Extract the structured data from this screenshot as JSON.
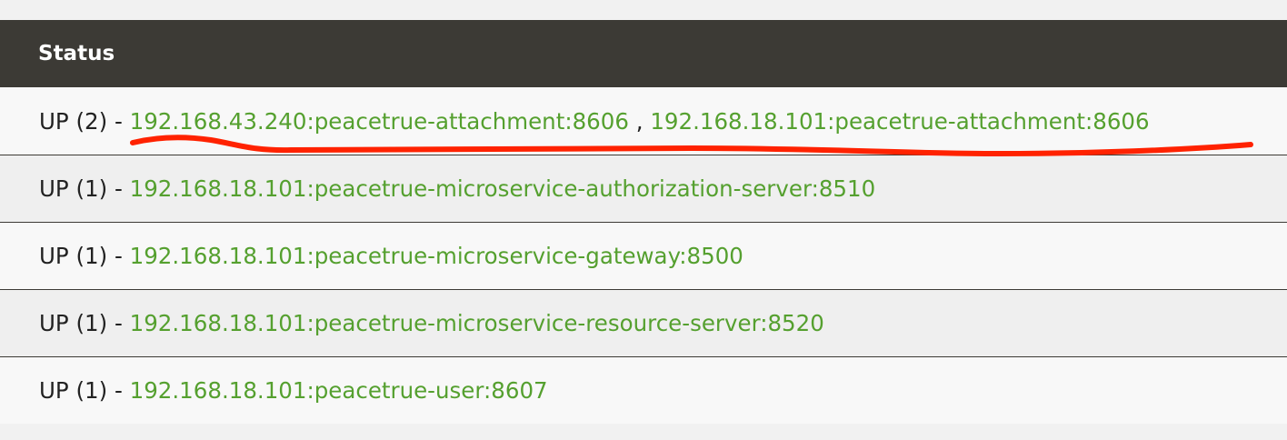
{
  "table": {
    "header": "Status",
    "rows": [
      {
        "status": "UP (2)",
        "separator": " - ",
        "links": [
          "192.168.43.240:peacetrue-attachment:8606",
          "192.168.18.101:peacetrue-attachment:8606"
        ],
        "link_separator": " , "
      },
      {
        "status": "UP (1)",
        "separator": " - ",
        "links": [
          "192.168.18.101:peacetrue-microservice-authorization-server:8510"
        ]
      },
      {
        "status": "UP (1)",
        "separator": " - ",
        "links": [
          "192.168.18.101:peacetrue-microservice-gateway:8500"
        ]
      },
      {
        "status": "UP (1)",
        "separator": " - ",
        "links": [
          "192.168.18.101:peacetrue-microservice-resource-server:8520"
        ]
      },
      {
        "status": "UP (1)",
        "separator": " - ",
        "links": [
          "192.168.18.101:peacetrue-user:8607"
        ]
      }
    ]
  },
  "colors": {
    "header_bg": "#3c3a35",
    "link": "#55a02f",
    "annotation": "#ff2200"
  }
}
